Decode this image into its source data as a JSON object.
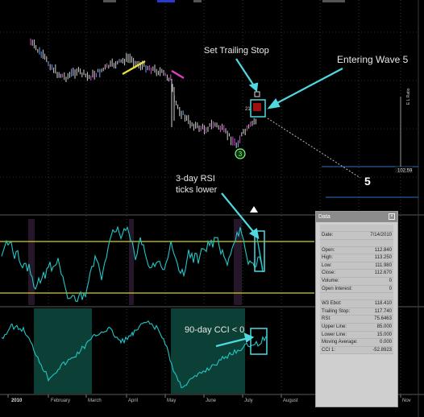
{
  "annotations": {
    "trailing_stop": "Set Trailing Stop",
    "entering_wave": "Entering Wave 5",
    "wave_3": "3",
    "wave_5": "5",
    "rsi_line1": "3-day RSI",
    "rsi_line2": "ticks lower",
    "cci_note": "90-day CCI < 0",
    "price_marker_1": "21",
    "price_label": "102.59",
    "right_label": "E L Ratio"
  },
  "x_axis": {
    "labels": [
      "2010",
      "February",
      "March",
      "April",
      "May",
      "June",
      "July",
      "August",
      "Nov"
    ]
  },
  "data_panel": {
    "title": "Data",
    "close": "×",
    "rows_a": [
      {
        "label": "Date:",
        "value": "7/14/2010"
      }
    ],
    "rows_b": [
      {
        "label": "Open:",
        "value": "112.840"
      },
      {
        "label": "High:",
        "value": "113.250"
      },
      {
        "label": "Low:",
        "value": "111.980"
      },
      {
        "label": "Close:",
        "value": "112.670"
      },
      {
        "label": "Volume:",
        "value": "0"
      },
      {
        "label": "Open Interest:",
        "value": "0"
      }
    ],
    "rows_c": [
      {
        "label": "W3 Ebot:",
        "value": "118.410"
      },
      {
        "label": "Trailing Stop:",
        "value": "117.740"
      },
      {
        "label": "RSI:",
        "value": "75.6463"
      },
      {
        "label": "Upper Line:",
        "value": "85.000"
      },
      {
        "label": "Lower Line:",
        "value": "15.000"
      },
      {
        "label": "Moving Average:",
        "value": "0.000"
      },
      {
        "label": "CCI 1:",
        "value": "-52.8923"
      }
    ]
  },
  "colors": {
    "background": "#000000",
    "price_bar": "#d0d0d0",
    "indicator": "#21c7c7",
    "rsi_band": "#d7d21a",
    "annotation": "#4fd8e0",
    "cci_shade": "#0e4a40",
    "wave_marker": "#7fff7f",
    "sell_line": "#e040c0",
    "buy_line": "#e8e040"
  }
}
